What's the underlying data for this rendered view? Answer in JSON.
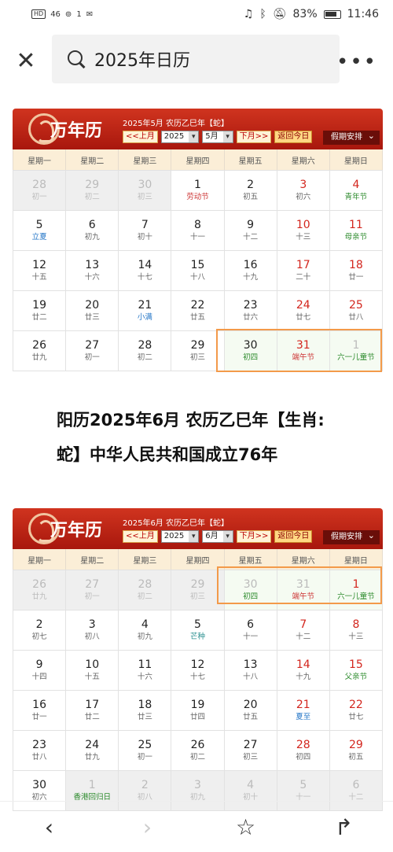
{
  "status": {
    "hd": "HD",
    "signal": "46",
    "wifi": "1",
    "battery": "83%",
    "time": "11:46"
  },
  "search": {
    "query": "2025年日历"
  },
  "heading": {
    "line1": "阳历2025年6月 农历乙巳年【生肖:",
    "line2": "蛇】中华人民共和国成立76年"
  },
  "cal1": {
    "title": "万年历",
    "sub": "2025年5月 农历乙巳年【蛇】",
    "prev": "<<上月",
    "year": "2025",
    "month": "5月",
    "next": "下月>>",
    "today": "返回今日",
    "holiday": "假期安排",
    "weekdays": [
      "星期一",
      "星期二",
      "星期三",
      "星期四",
      "星期五",
      "星期六",
      "星期日"
    ],
    "cells": [
      {
        "d": "28",
        "l": "初一",
        "t": "other"
      },
      {
        "d": "29",
        "l": "初二",
        "t": "other"
      },
      {
        "d": "30",
        "l": "初三",
        "t": "other"
      },
      {
        "d": "1",
        "l": "劳动节",
        "c": "red"
      },
      {
        "d": "2",
        "l": "初五"
      },
      {
        "d": "3",
        "l": "初六",
        "w": 1
      },
      {
        "d": "4",
        "l": "青年节",
        "c": "green",
        "w": 1
      },
      {
        "d": "5",
        "l": "立夏",
        "c": "blue"
      },
      {
        "d": "6",
        "l": "初九"
      },
      {
        "d": "7",
        "l": "初十"
      },
      {
        "d": "8",
        "l": "十一"
      },
      {
        "d": "9",
        "l": "十二"
      },
      {
        "d": "10",
        "l": "十三",
        "w": 1
      },
      {
        "d": "11",
        "l": "母亲节",
        "c": "green",
        "w": 1
      },
      {
        "d": "12",
        "l": "十五"
      },
      {
        "d": "13",
        "l": "十六"
      },
      {
        "d": "14",
        "l": "十七"
      },
      {
        "d": "15",
        "l": "十八"
      },
      {
        "d": "16",
        "l": "十九"
      },
      {
        "d": "17",
        "l": "二十",
        "w": 1
      },
      {
        "d": "18",
        "l": "廿一",
        "w": 1
      },
      {
        "d": "19",
        "l": "廿二"
      },
      {
        "d": "20",
        "l": "廿三"
      },
      {
        "d": "21",
        "l": "小满",
        "c": "blue"
      },
      {
        "d": "22",
        "l": "廿五"
      },
      {
        "d": "23",
        "l": "廿六"
      },
      {
        "d": "24",
        "l": "廿七",
        "w": 1
      },
      {
        "d": "25",
        "l": "廿八",
        "w": 1
      },
      {
        "d": "26",
        "l": "廿九"
      },
      {
        "d": "27",
        "l": "初一"
      },
      {
        "d": "28",
        "l": "初二"
      },
      {
        "d": "29",
        "l": "初三"
      },
      {
        "d": "30",
        "l": "初四",
        "c": "green",
        "t": "hl"
      },
      {
        "d": "31",
        "l": "端午节",
        "c": "red",
        "w": 1,
        "t": "hl"
      },
      {
        "d": "1",
        "l": "六一儿童节",
        "c": "green",
        "t": "hlother"
      }
    ]
  },
  "cal2": {
    "title": "万年历",
    "sub": "2025年6月 农历乙巳年【蛇】",
    "prev": "<<上月",
    "year": "2025",
    "month": "6月",
    "next": "下月>>",
    "today": "返回今日",
    "holiday": "假期安排",
    "weekdays": [
      "星期一",
      "星期二",
      "星期三",
      "星期四",
      "星期五",
      "星期六",
      "星期日"
    ],
    "cells": [
      {
        "d": "26",
        "l": "廿九",
        "t": "other"
      },
      {
        "d": "27",
        "l": "初一",
        "t": "other"
      },
      {
        "d": "28",
        "l": "初二",
        "t": "other"
      },
      {
        "d": "29",
        "l": "初三",
        "t": "other"
      },
      {
        "d": "30",
        "l": "初四",
        "c": "green",
        "t": "hlother"
      },
      {
        "d": "31",
        "l": "端午节",
        "c": "red",
        "t": "hlother"
      },
      {
        "d": "1",
        "l": "六一儿童节",
        "c": "green",
        "w": 1,
        "t": "hl"
      },
      {
        "d": "2",
        "l": "初七"
      },
      {
        "d": "3",
        "l": "初八"
      },
      {
        "d": "4",
        "l": "初九"
      },
      {
        "d": "5",
        "l": "芒种",
        "c": "teal"
      },
      {
        "d": "6",
        "l": "十一"
      },
      {
        "d": "7",
        "l": "十二",
        "w": 1
      },
      {
        "d": "8",
        "l": "十三",
        "w": 1
      },
      {
        "d": "9",
        "l": "十四"
      },
      {
        "d": "10",
        "l": "十五"
      },
      {
        "d": "11",
        "l": "十六"
      },
      {
        "d": "12",
        "l": "十七"
      },
      {
        "d": "13",
        "l": "十八"
      },
      {
        "d": "14",
        "l": "十九",
        "w": 1
      },
      {
        "d": "15",
        "l": "父亲节",
        "c": "green",
        "w": 1
      },
      {
        "d": "16",
        "l": "廿一"
      },
      {
        "d": "17",
        "l": "廿二"
      },
      {
        "d": "18",
        "l": "廿三"
      },
      {
        "d": "19",
        "l": "廿四"
      },
      {
        "d": "20",
        "l": "廿五"
      },
      {
        "d": "21",
        "l": "夏至",
        "c": "blue",
        "w": 1
      },
      {
        "d": "22",
        "l": "廿七",
        "w": 1
      },
      {
        "d": "23",
        "l": "廿八"
      },
      {
        "d": "24",
        "l": "廿九"
      },
      {
        "d": "25",
        "l": "初一"
      },
      {
        "d": "26",
        "l": "初二"
      },
      {
        "d": "27",
        "l": "初三"
      },
      {
        "d": "28",
        "l": "初四",
        "w": 1
      },
      {
        "d": "29",
        "l": "初五",
        "w": 1
      },
      {
        "d": "30",
        "l": "初六"
      },
      {
        "d": "1",
        "l": "香港回归日",
        "c": "green",
        "t": "other"
      },
      {
        "d": "2",
        "l": "初八",
        "t": "other"
      },
      {
        "d": "3",
        "l": "初九",
        "t": "other"
      },
      {
        "d": "4",
        "l": "初十",
        "t": "other"
      },
      {
        "d": "5",
        "l": "十一",
        "t": "other"
      },
      {
        "d": "6",
        "l": "十二",
        "t": "other"
      }
    ]
  },
  "nav": {
    "back": "‹",
    "forward": "›",
    "star": "☆",
    "share": "↱"
  }
}
